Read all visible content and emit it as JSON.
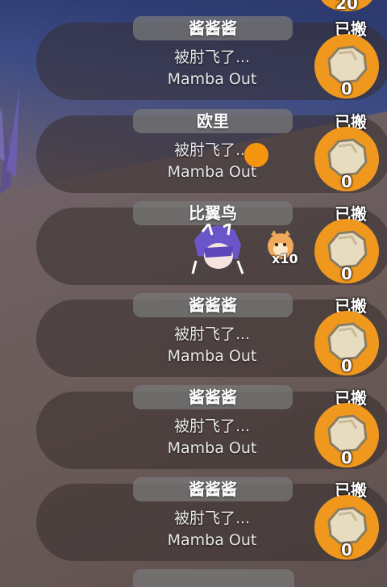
{
  "top": {
    "count": "20"
  },
  "rows": [
    {
      "name": "酱酱酱",
      "status": "已搬",
      "count": "0",
      "message_line1": "被肘飞了...",
      "message_line2": "Mamba Out"
    },
    {
      "name": "欧里",
      "status": "已搬",
      "count": "0",
      "message_line1": "被肘飞了...",
      "message_line2": "Mamba Out"
    },
    {
      "name": "比翼鸟",
      "status": "已搬",
      "count": "0",
      "pet_multiplier": "x10"
    },
    {
      "name": "酱酱酱",
      "status": "已搬",
      "count": "0",
      "message_line1": "被肘飞了...",
      "message_line2": "Mamba Out"
    },
    {
      "name": "酱酱酱",
      "status": "已搬",
      "count": "0",
      "message_line1": "被肘飞了...",
      "message_line2": "Mamba Out"
    },
    {
      "name": "酱酱酱",
      "status": "已搬",
      "count": "0",
      "message_line1": "被肘飞了...",
      "message_line2": "Mamba Out"
    }
  ],
  "icons": {
    "resource": "stone-icon",
    "avatar": "character-avatar-icon",
    "pet": "pet-icon"
  },
  "colors": {
    "accent_orange": "#f0981e",
    "row_bg": "#372d2d",
    "name_pill": "#787878"
  }
}
